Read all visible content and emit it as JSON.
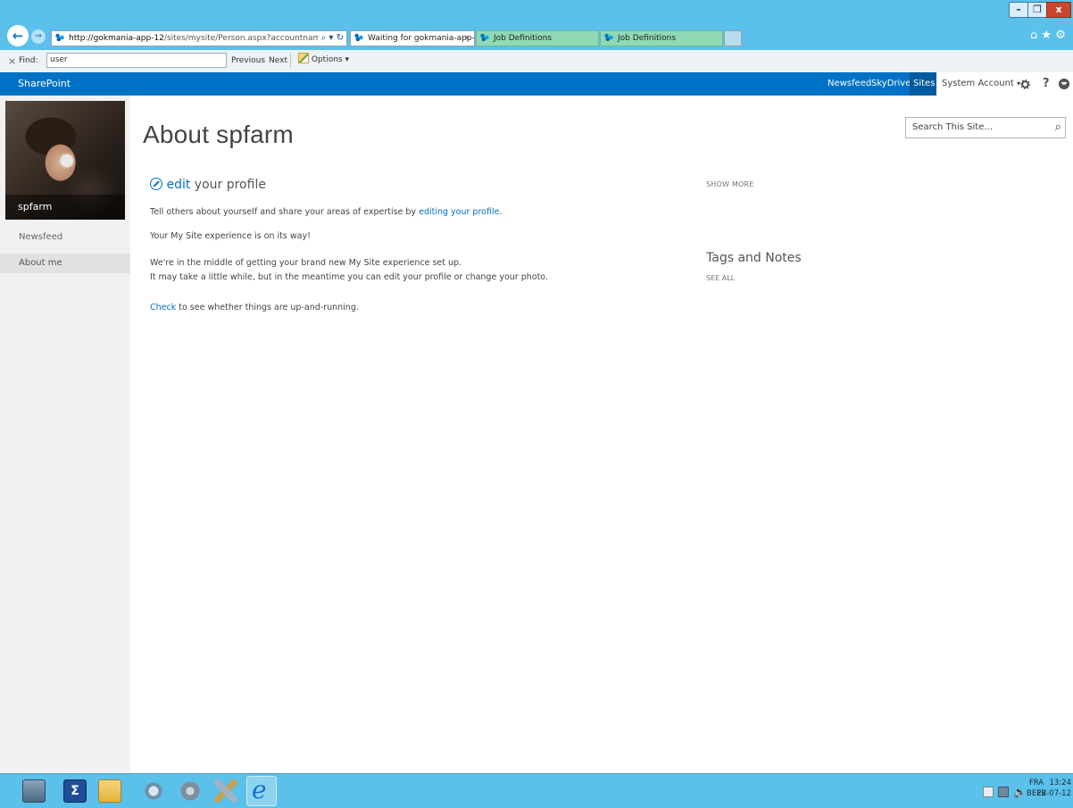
{
  "browser": {
    "address": {
      "url_host": "http://gokmania-app-12",
      "url_path": "/sites/mysite/Person.aspx?accountname=SPPIRATE"
    },
    "address_controls": {
      "search": "⌕",
      "dropdown": "▾",
      "refresh": "↻"
    },
    "tabs": [
      {
        "label": "Waiting for gokmania-app-...",
        "close": "×"
      },
      {
        "label": "Job Definitions"
      },
      {
        "label": "Job Definitions"
      }
    ],
    "window_controls": {
      "minimize": "–",
      "maximize": "❐",
      "close": "x"
    },
    "toolbar_icons": {
      "home": "⌂",
      "favorites": "★",
      "tools": "⚙"
    }
  },
  "findbar": {
    "close": "×",
    "label": "Find:",
    "value": "user",
    "previous": "Previous",
    "next": "Next",
    "options": "Options",
    "options_arrow": "▾"
  },
  "suitebar": {
    "brand": "SharePoint",
    "links": [
      "Newsfeed",
      "SkyDrive",
      "Sites"
    ],
    "account": "System Account",
    "account_arrow": "▾",
    "help": "?",
    "colors": {
      "bar": "#0072c6",
      "active_link_bg": "#005a9e"
    }
  },
  "sidebar": {
    "user_name": "spfarm",
    "nav": [
      {
        "label": "Newsfeed"
      },
      {
        "label": "About me"
      }
    ]
  },
  "search": {
    "placeholder": "Search This Site..."
  },
  "main": {
    "title": "About spfarm",
    "edit_profile": {
      "edit": "edit",
      "rest": "your profile"
    },
    "intro": {
      "before": "Tell others about yourself and share your areas of expertise by ",
      "link": "editing your profile",
      "after": "."
    },
    "msg1": "Your My Site experience is on its way!",
    "msg2": "We're in the middle of getting your brand new My Site experience set up.",
    "msg3": "It may take a little while, but in the meantime you can edit your profile or change your photo.",
    "check": {
      "link": "Check",
      "rest": " to see whether things are up-and-running."
    }
  },
  "right_panel": {
    "show_more": "SHOW MORE",
    "tags_heading": "Tags and Notes",
    "see_all": "SEE ALL"
  },
  "taskbar": {
    "clock": {
      "lang_line1": "FRA",
      "lang_line2": "BEFR",
      "time": "13:24",
      "date": "22-07-12"
    },
    "pinned": [
      "server-manager",
      "powershell",
      "file-explorer",
      "network",
      "settings",
      "tools",
      "internet-explorer"
    ]
  }
}
